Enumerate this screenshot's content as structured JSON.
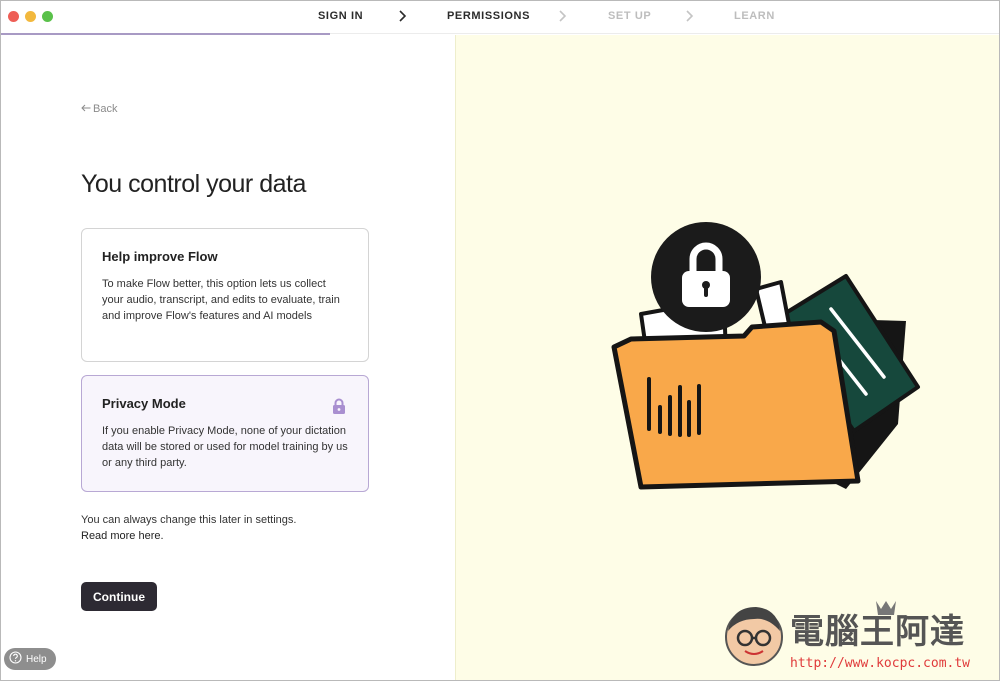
{
  "window": {
    "traffic_colors": [
      "#ee5e56",
      "#f2b83d",
      "#5ac14a"
    ]
  },
  "steps": [
    {
      "label": "SIGN IN",
      "state": "done"
    },
    {
      "label": "PERMISSIONS",
      "state": "active"
    },
    {
      "label": "SET UP",
      "state": "upcoming"
    },
    {
      "label": "LEARN",
      "state": "upcoming"
    }
  ],
  "onboarding_progress": 0.33,
  "nav": {
    "back_label": "Back"
  },
  "page": {
    "title": "You control your data"
  },
  "options": [
    {
      "title": "Help improve Flow",
      "description": "To make Flow better, this option lets us collect your audio, transcript, and edits to evaluate, train and improve Flow's features and AI models",
      "selected": false
    },
    {
      "title": "Privacy Mode",
      "description": "If you enable Privacy Mode, none of your dictation data will be stored or used for model training by us or any third party.",
      "selected": true,
      "icon": "lock-icon"
    }
  ],
  "note": {
    "text": "You can always change this later in settings.",
    "link": "Read more here."
  },
  "buttons": {
    "continue": "Continue",
    "help": "Help"
  },
  "watermark": {
    "brand": "電腦王阿達",
    "url": "http://www.kocpc.com.tw"
  },
  "colors": {
    "accent_purple": "#b8a8d4",
    "illustration_bg": "#fefde7",
    "folder_orange": "#f9a84a",
    "card_green": "#16483c"
  }
}
